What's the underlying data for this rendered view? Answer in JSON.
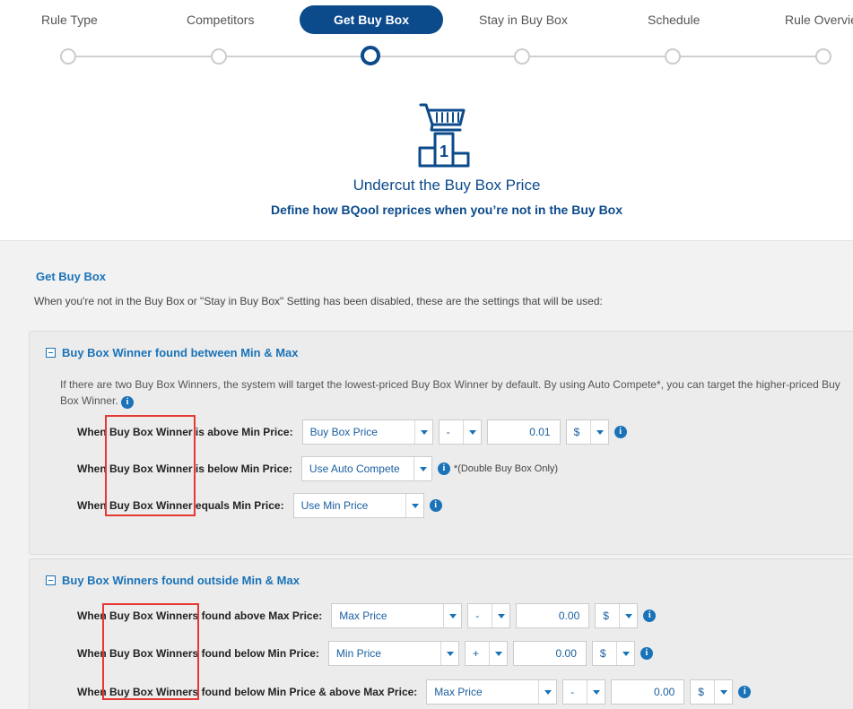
{
  "steps": [
    {
      "label": "Rule Type"
    },
    {
      "label": "Competitors"
    },
    {
      "label": "Get Buy Box"
    },
    {
      "label": "Stay in Buy Box"
    },
    {
      "label": "Schedule"
    },
    {
      "label": "Rule Overvie"
    }
  ],
  "hero": {
    "icon": "cart-podium-icon",
    "title": "Undercut the Buy Box Price",
    "subtitle": "Define how BQool reprices when you’re not in the Buy Box"
  },
  "section": {
    "title": "Get Buy Box",
    "description": "When you're not in the Buy Box or \"Stay in Buy Box\" Setting has been disabled, these are the settings that will be used:"
  },
  "panel1": {
    "title": "Buy Box Winner found between Min & Max",
    "note": "If there are two Buy Box Winners, the system will target the lowest-priced Buy Box Winner by default. By using Auto Compete*, you can target the higher-priced Buy Box Winner.",
    "rows": [
      {
        "label": "When Buy Box Winner is above Min Price:",
        "select": "Buy Box Price",
        "operator": "-",
        "amount": "0.01",
        "unit": "$"
      },
      {
        "label": "When Buy Box Winner is below Min Price:",
        "select": "Use Auto Compete",
        "note": "*(Double Buy Box Only)"
      },
      {
        "label": "When Buy Box Winner equals Min Price:",
        "select": "Use Min Price"
      }
    ]
  },
  "panel2": {
    "title": "Buy Box Winners found outside Min & Max",
    "rows": [
      {
        "label": "When Buy Box Winners found above Max Price:",
        "select": "Max Price",
        "operator": "-",
        "amount": "0.00",
        "unit": "$"
      },
      {
        "label": "When Buy Box Winners found below Min Price:",
        "select": "Min Price",
        "operator": "+",
        "amount": "0.00",
        "unit": "$"
      },
      {
        "label": "When Buy Box Winners found below Min Price & above Max Price:",
        "select": "Max Price",
        "operator": "-",
        "amount": "0.00",
        "unit": "$"
      }
    ]
  },
  "colors": {
    "primary": "#0b4a8b",
    "link": "#1a73b8",
    "highlight": "#e53935"
  }
}
